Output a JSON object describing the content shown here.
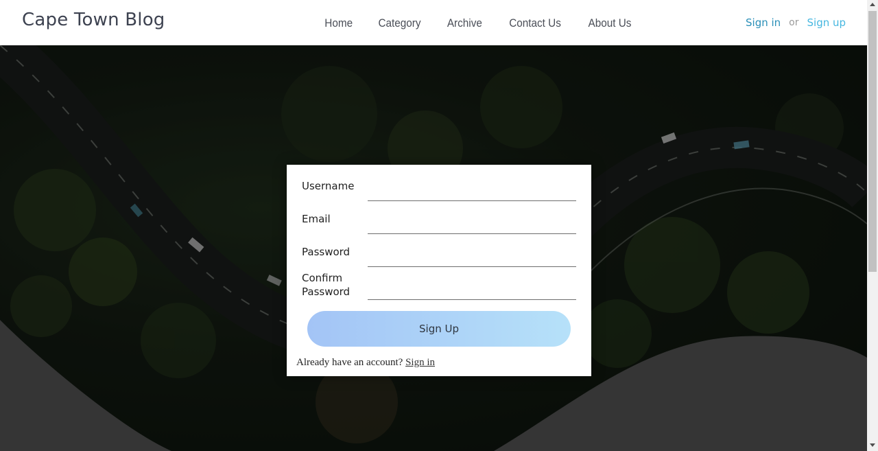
{
  "header": {
    "brand": "Cape Town Blog",
    "nav": [
      "Home",
      "Category",
      "Archive",
      "Contact Us",
      "About Us"
    ],
    "sign_in": "Sign in",
    "or": "or",
    "sign_up": "Sign up"
  },
  "form": {
    "username_label": "Username",
    "email_label": "Email",
    "password_label": "Password",
    "confirm_label_1": "Confirm",
    "confirm_label_2": "Password",
    "submit": "Sign Up",
    "already_text": "Already have an account?",
    "sign_in_link": "Sign in"
  },
  "colors": {
    "accent_signin": "#2a8fb8",
    "accent_signup": "#46b7e0",
    "button_start": "#a3c4f6",
    "button_end": "#b6e1f9"
  }
}
